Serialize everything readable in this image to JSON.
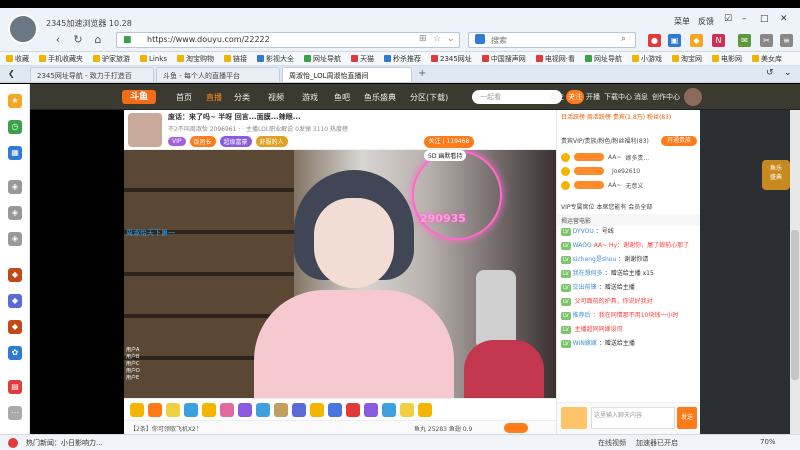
{
  "browser": {
    "title": "2345加速浏览器 10.28",
    "url": "https://www.douyu.com/22222",
    "search_placeholder": "搜索",
    "window_labels": [
      "菜单",
      "反馈"
    ],
    "bookmarks": [
      "收藏",
      "手机收藏夹",
      "驴家旅游",
      "Links",
      "淘宝购物",
      "链接",
      "影视大全",
      "网址导航",
      "天猫",
      "秒杀推荐",
      "2345网址",
      "中国搜声网",
      "电视网·看",
      "网址导航",
      "小游戏",
      "淘宝网",
      "电影网",
      "美女库"
    ],
    "tabs": [
      "2345网址导航 - 致力于打造百",
      "斗鱼 - 每个人的直播平台",
      "周淑怡_LOL周淑怡直播间"
    ],
    "status_text": "热门新闻：小日影响力...",
    "status_right": [
      "在线视频",
      "加速器已开启"
    ],
    "zoom": "70%"
  },
  "site": {
    "logo": "斗鱼",
    "nav": [
      "首页",
      "直播",
      "分类",
      "视频",
      "游戏",
      "鱼吧",
      "鱼乐盛典",
      "分区(下载)"
    ],
    "search_placeholder": "一起看",
    "user_nav": [
      "历史",
      "关注",
      "开播",
      "下载中心",
      "消息",
      "创作中心"
    ]
  },
  "room": {
    "title": "废话：来了吗~ 半呀 回言...面膜...辣眼...",
    "meta": "不2不叫周淑怡  2096961  ·  ·  主播LOL职业解说  0发弹  3110 热度榜",
    "tags": [
      "VIP",
      "饭团长",
      "超级富豪",
      "舒服的人"
    ],
    "follow": "关注 | 119468",
    "badge": "5D 幽默看持",
    "neon_number": "290935",
    "watermark": "周淑怡天下第一",
    "viewers": [
      "用户A",
      "用户B",
      "用户C",
      "用户D",
      "用户E"
    ]
  },
  "gift_bar": {
    "rank": "【2条】你可领取飞机X2！",
    "fish": "鱼丸 25283  鱼翅 0.9"
  },
  "right_panel": {
    "header": "日活跃榜  周活跃榜  贵宾(1.8万)  粉丝(83)",
    "vip_line": "贵宾VIP/贵族/粉色/粉丝福利(83)",
    "vip_button": "开通贵族",
    "ranks": [
      {
        "name": "AA~",
        "text": "嫁多贵..."
      },
      {
        "name": "",
        "text": "Joe92610"
      },
      {
        "name": "AA~",
        "text": "无意义"
      }
    ],
    "vip_notice": "VIP专属席位 本席您能有 会员全部",
    "welcome": "揭运营电影",
    "chats": [
      {
        "lv": "LV",
        "name": "DYVOU",
        "text": "：号线"
      },
      {
        "lv": "LV",
        "name": "WAOO",
        "text": "AA~ Hy：谢谢你，屠了娘前心那了"
      },
      {
        "lv": "LV",
        "name": "sicheng是shou",
        "text": "：谢谢你请"
      },
      {
        "lv": "LV",
        "name": "我在想何多",
        "text": "：赠送给主播 x15"
      },
      {
        "lv": "LV",
        "name": "交出前锋",
        "text": "：赠送给主播"
      },
      {
        "lv": "LV",
        "name": "",
        "text": "父可面前的护具，你说好我对"
      },
      {
        "lv": "LV",
        "name": "推荐后",
        "text": "：我在同情那不用10块钱一小时"
      },
      {
        "lv": "LV",
        "name": "",
        "text": "主播超同同嫁设司"
      },
      {
        "lv": "LV",
        "name": "WIN嫁嫁",
        "text": "：赠送给主播"
      }
    ],
    "chat_placeholder": "这里输入聊天内容",
    "send": "发送"
  },
  "promo": {
    "line1": "鱼乐",
    "line2": "盛典"
  }
}
